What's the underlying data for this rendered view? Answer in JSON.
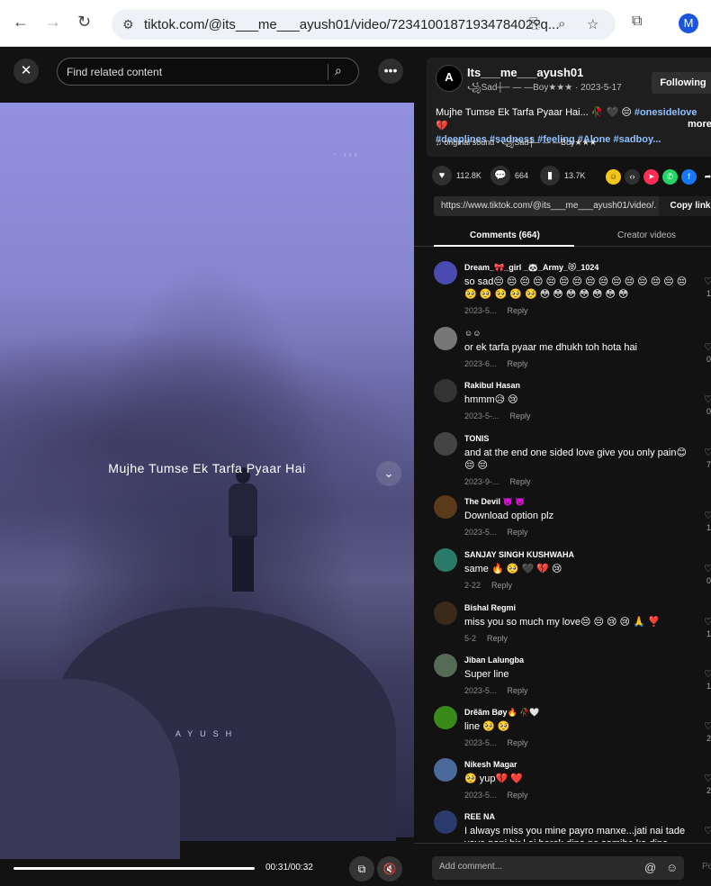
{
  "browser": {
    "url": "tiktok.com/@its___me___ayush01/video/7234100187193478402?q...",
    "back_icon": "←",
    "forward_icon": "→",
    "reload_icon": "↻",
    "profile_initial": "M"
  },
  "video": {
    "search_placeholder": "Find related content",
    "overlay_title": "Mujhe Tumse Ek Tarfa Pyaar Hai",
    "watermark": "AYUSH",
    "progress": 0.97,
    "time": "00:31/00:32"
  },
  "author": {
    "avatar_label": "A",
    "name": "Its___me___ayush01",
    "subtitle": "꧁Sad┼─ — —Boy★★★ · 2023-5-17",
    "follow_label": "Following"
  },
  "description": {
    "text": "Mujhe Tumse Ek Tarfa Pyaar Hai... 🥀 🖤 😔 ",
    "tag1": "#onesidelove",
    "emoji": " 💔",
    "tags2": "#deeplines #sadness #feeling #Alone #sadboy...",
    "more": "more",
    "sound": "♫  original sound - ꧁Sad┼─ — —Boy★★★"
  },
  "stats": {
    "likes": "112.8K",
    "comments": "664",
    "saves": "13.7K"
  },
  "link": {
    "url": "https://www.tiktok.com/@its___me___ayush01/video/...",
    "copy_label": "Copy link"
  },
  "tabs": {
    "comments": "Comments (664)",
    "creator": "Creator videos"
  },
  "comments": [
    {
      "user": "Dream_🎀_girl _🐼_Army_😻_1024",
      "text": "so sad😔 😔 😔 😔 😔 😔 😔 😔 😔 😔 😔 😔 😔 😔 😔 🥺 🥺 🥺 🥺 🥺 😳 😳 😳 😳 😳 😳 😳",
      "date": "2023-5...",
      "count": "1",
      "color": "#4a4ab0"
    },
    {
      "user": "☺☺",
      "text": "or ek tarfa pyaar me dhukh toh hota hai",
      "date": "2023-6...",
      "count": "0",
      "color": "#777"
    },
    {
      "user": "Rakibul Hasan",
      "text": "hmmm😥 😢",
      "date": "2023-5-...",
      "count": "0",
      "color": "#333"
    },
    {
      "user": "TONIS",
      "text": "and at the end one sided love give you only pain😊 😔 😔",
      "date": "2023-9-...",
      "count": "7",
      "color": "#444"
    },
    {
      "user": "The Devil 👿 👿",
      "text": "Download option plz",
      "date": "2023-5...",
      "count": "1",
      "color": "#5a3a1a"
    },
    {
      "user": "SANJAY SINGH KUSHWAHA",
      "text": "same 🔥 🥺 🖤 💔 😢",
      "date": "2-22",
      "count": "0",
      "color": "#2a7a6a"
    },
    {
      "user": "Bishal Regmi",
      "text": "miss you so much my love😔 😔 😢 😢 🙏 ❣️",
      "date": "5-2",
      "count": "1",
      "color": "#3a2a1a"
    },
    {
      "user": "Jiban Lalungba",
      "text": "Super line",
      "date": "2023-5...",
      "count": "1",
      "color": "#556b55"
    },
    {
      "user": "Drẽãm Bøy🔥 🥀🤍",
      "text": "line 🥺 🥺",
      "date": "2023-5...",
      "count": "2",
      "color": "#3a8a1a"
    },
    {
      "user": "Nikesh Magar",
      "text": "🥺 yup💔 ❤️",
      "date": "2023-5...",
      "count": "2",
      "color": "#4a6a9a"
    },
    {
      "user": "REE NA",
      "text": "I always miss you mine payro manxe...jati nai tade vaye pani hjr l ai herek dina ne samjhe ka dina",
      "date": "",
      "count": "",
      "color": "#2a3a6a"
    }
  ],
  "add_comment": {
    "placeholder": "Add comment...",
    "post": "Post"
  }
}
